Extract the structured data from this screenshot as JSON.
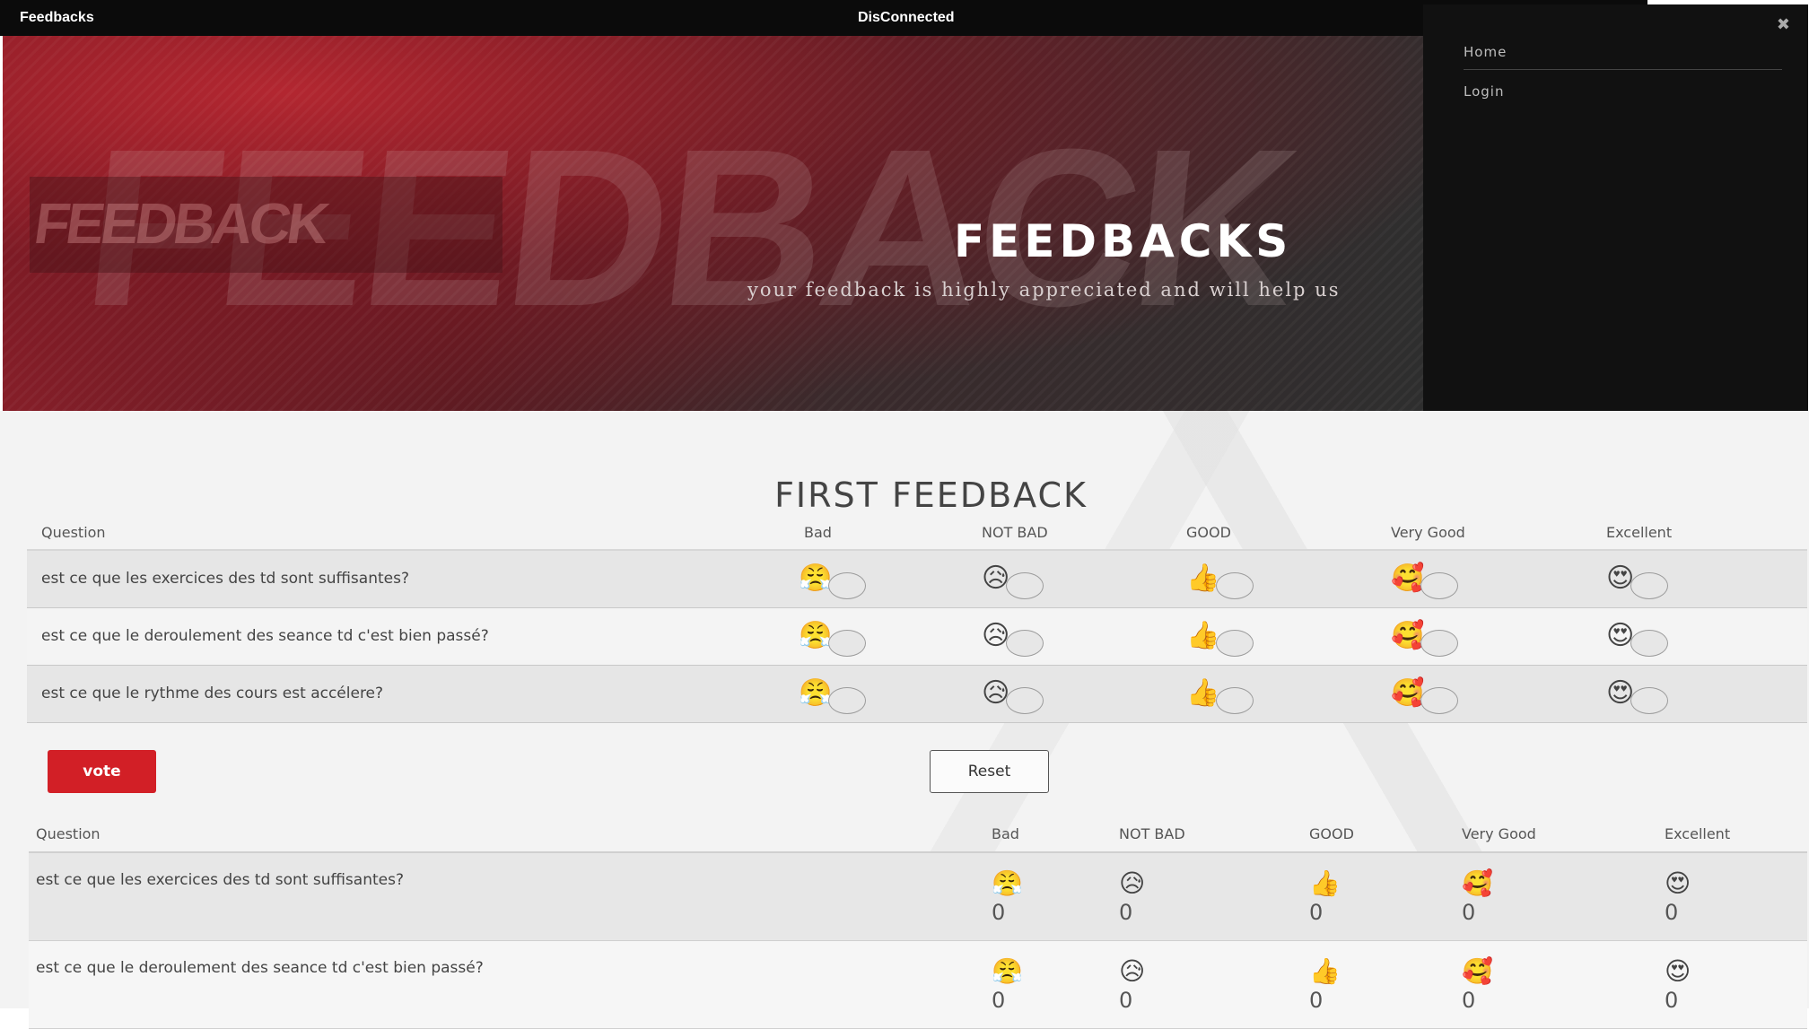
{
  "topbar": {
    "brand": "Feedbacks",
    "status": "DisConnected"
  },
  "hero": {
    "title": "FEEDBACKS",
    "subtitle": "your feedback is highly appreciated and will help us",
    "background_text_large": "FEEDBACK",
    "background_text_small": "FEEDBACK"
  },
  "side_menu": {
    "close_icon": "✖",
    "items": [
      {
        "label": "Home"
      },
      {
        "label": "Login"
      }
    ]
  },
  "section1": {
    "title": "FIRST FEEDBACK"
  },
  "vote_table": {
    "headers": [
      "Question",
      "Bad",
      "NOT BAD",
      "GOOD",
      "Very Good",
      "Excellent"
    ],
    "emojis": [
      "😤",
      "😥",
      "👍",
      "🥰",
      "😍"
    ],
    "rows": [
      {
        "question": "est ce que les exercices des td sont suffisantes?"
      },
      {
        "question": "est ce que le deroulement des seance td c'est bien passé?"
      },
      {
        "question": "est ce que le rythme des cours est accélere?"
      }
    ]
  },
  "buttons": {
    "vote": "vote",
    "reset": "Reset"
  },
  "results_table": {
    "headers": [
      "Question",
      "Bad",
      "NOT BAD",
      "GOOD",
      "Very Good",
      "Excellent"
    ],
    "rows": [
      {
        "question": "est ce que les exercices des td sont suffisantes?",
        "counts": [
          "0",
          "0",
          "0",
          "0",
          "0"
        ]
      },
      {
        "question": "est ce que le deroulement des seance td c'est bien passé?",
        "counts": [
          "0",
          "0",
          "0",
          "0",
          "0"
        ]
      }
    ]
  },
  "colors": {
    "accent": "#d21f26",
    "topbar": "#0b0b0b",
    "sidemenu": "#111111"
  }
}
